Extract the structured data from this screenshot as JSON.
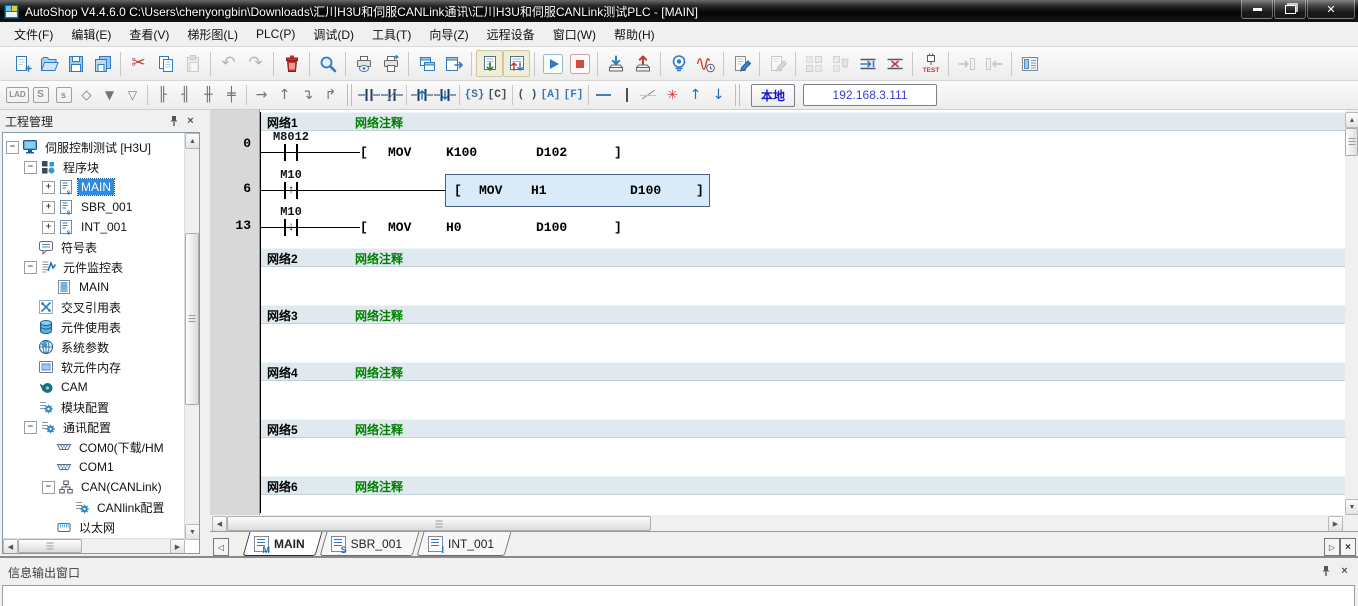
{
  "window": {
    "title": "AutoShop V4.4.6.0  C:\\Users\\chenyongbin\\Downloads\\汇川H3U和伺服CANLink通讯\\汇川H3U和伺服CANLink测试PLC - [MAIN]"
  },
  "menu": {
    "items": [
      "文件(F)",
      "编辑(E)",
      "查看(V)",
      "梯形图(L)",
      "PLC(P)",
      "调试(D)",
      "工具(T)",
      "向导(Z)",
      "远程设备",
      "窗口(W)",
      "帮助(H)"
    ]
  },
  "toolbar": {
    "local_label": "本地",
    "ip": "192.168.3.111",
    "main_buttons": [
      "new",
      "open",
      "save",
      "save-all",
      "cut",
      "copy",
      "paste",
      "undo",
      "redo",
      "delete",
      "find",
      "print-preview",
      "print",
      "cascade-windows",
      "export-window",
      "import-program",
      "export-program",
      "run",
      "stop",
      "download",
      "upload",
      "monitor",
      "trace-scope",
      "edit-write",
      "edit-read",
      "convert",
      "convert-delete",
      "insert-row",
      "delete-row",
      "simulate-test",
      "step-in",
      "step-out",
      "memory-view"
    ],
    "ladder_buttons": [
      "lad-mode",
      "s-block",
      "s-block-small",
      "branch",
      "insert-branch-down",
      "append-branch-down",
      "branch-open",
      "branch-close",
      "branch-merge",
      "branch-split",
      "wire-right",
      "wire-up",
      "wire-down-corner",
      "wire-up-corner",
      "contact-open",
      "contact-closed",
      "contact-rising",
      "contact-falling",
      "coil-set",
      "coil-counter",
      "coil-output",
      "coil-app",
      "coil-func",
      "draw-hline",
      "draw-vline",
      "delete-line",
      "delete-all-lines",
      "line-up",
      "line-down"
    ]
  },
  "icons": {
    "minimize": "–",
    "maximize": "❐",
    "close": "×",
    "pin": "pushpin",
    "search": "magnifier",
    "test_label": "TEST",
    "scroll_up": "▲",
    "scroll_down": "▼",
    "scroll_left": "◀",
    "scroll_right": "▶",
    "tab_prev": "◁",
    "tab_next": "▷"
  },
  "project": {
    "title": "工程管理",
    "items": [
      {
        "label": "伺服控制测试 [H3U]",
        "icon": "plc-project"
      },
      {
        "label": "程序块",
        "icon": "program-blocks"
      },
      {
        "label": "MAIN",
        "icon": "ladder-doc",
        "selected": true
      },
      {
        "label": "SBR_001",
        "icon": "ladder-doc"
      },
      {
        "label": "INT_001",
        "icon": "ladder-doc"
      },
      {
        "label": "符号表",
        "icon": "symbol-table"
      },
      {
        "label": "元件监控表",
        "icon": "watch-table"
      },
      {
        "label": "MAIN",
        "icon": "watch-doc"
      },
      {
        "label": "交叉引用表",
        "icon": "cross-reference"
      },
      {
        "label": "元件使用表",
        "icon": "usage-table"
      },
      {
        "label": "系统参数",
        "icon": "system-params"
      },
      {
        "label": "软元件内存",
        "icon": "device-memory"
      },
      {
        "label": "CAM",
        "icon": "cam"
      },
      {
        "label": "模块配置",
        "icon": "module-config"
      },
      {
        "label": "通讯配置",
        "icon": "comm-config"
      },
      {
        "label": "COM0(下载/HM",
        "icon": "com-port"
      },
      {
        "label": "COM1",
        "icon": "com-port"
      },
      {
        "label": "CAN(CANLink)",
        "icon": "can-network"
      },
      {
        "label": "CANlink配置",
        "icon": "canlink-config"
      },
      {
        "label": "以太网",
        "icon": "ethernet"
      }
    ]
  },
  "editor": {
    "networks": [
      {
        "name": "网络1",
        "comment": "网络注释"
      },
      {
        "name": "网络2",
        "comment": "网络注释"
      },
      {
        "name": "网络3",
        "comment": "网络注释"
      },
      {
        "name": "网络4",
        "comment": "网络注释"
      },
      {
        "name": "网络5",
        "comment": "网络注释"
      },
      {
        "name": "网络6",
        "comment": "网络注释"
      }
    ],
    "rungs": [
      {
        "step": "0",
        "device": "M8012",
        "edge": "none",
        "op": "MOV",
        "src": "K100",
        "dst": "D102",
        "selected": false
      },
      {
        "step": "6",
        "device": "M10",
        "edge": "rising",
        "op": "MOV",
        "src": "H1",
        "dst": "D100",
        "selected": true
      },
      {
        "step": "13",
        "device": "M10",
        "edge": "falling",
        "op": "MOV",
        "src": "H0",
        "dst": "D100",
        "selected": false
      }
    ],
    "tabs": [
      {
        "label": "MAIN",
        "active": true
      },
      {
        "label": "SBR_001",
        "active": false
      },
      {
        "label": "INT_001",
        "active": false
      }
    ]
  },
  "output_panel": {
    "title": "信息输出窗口"
  }
}
